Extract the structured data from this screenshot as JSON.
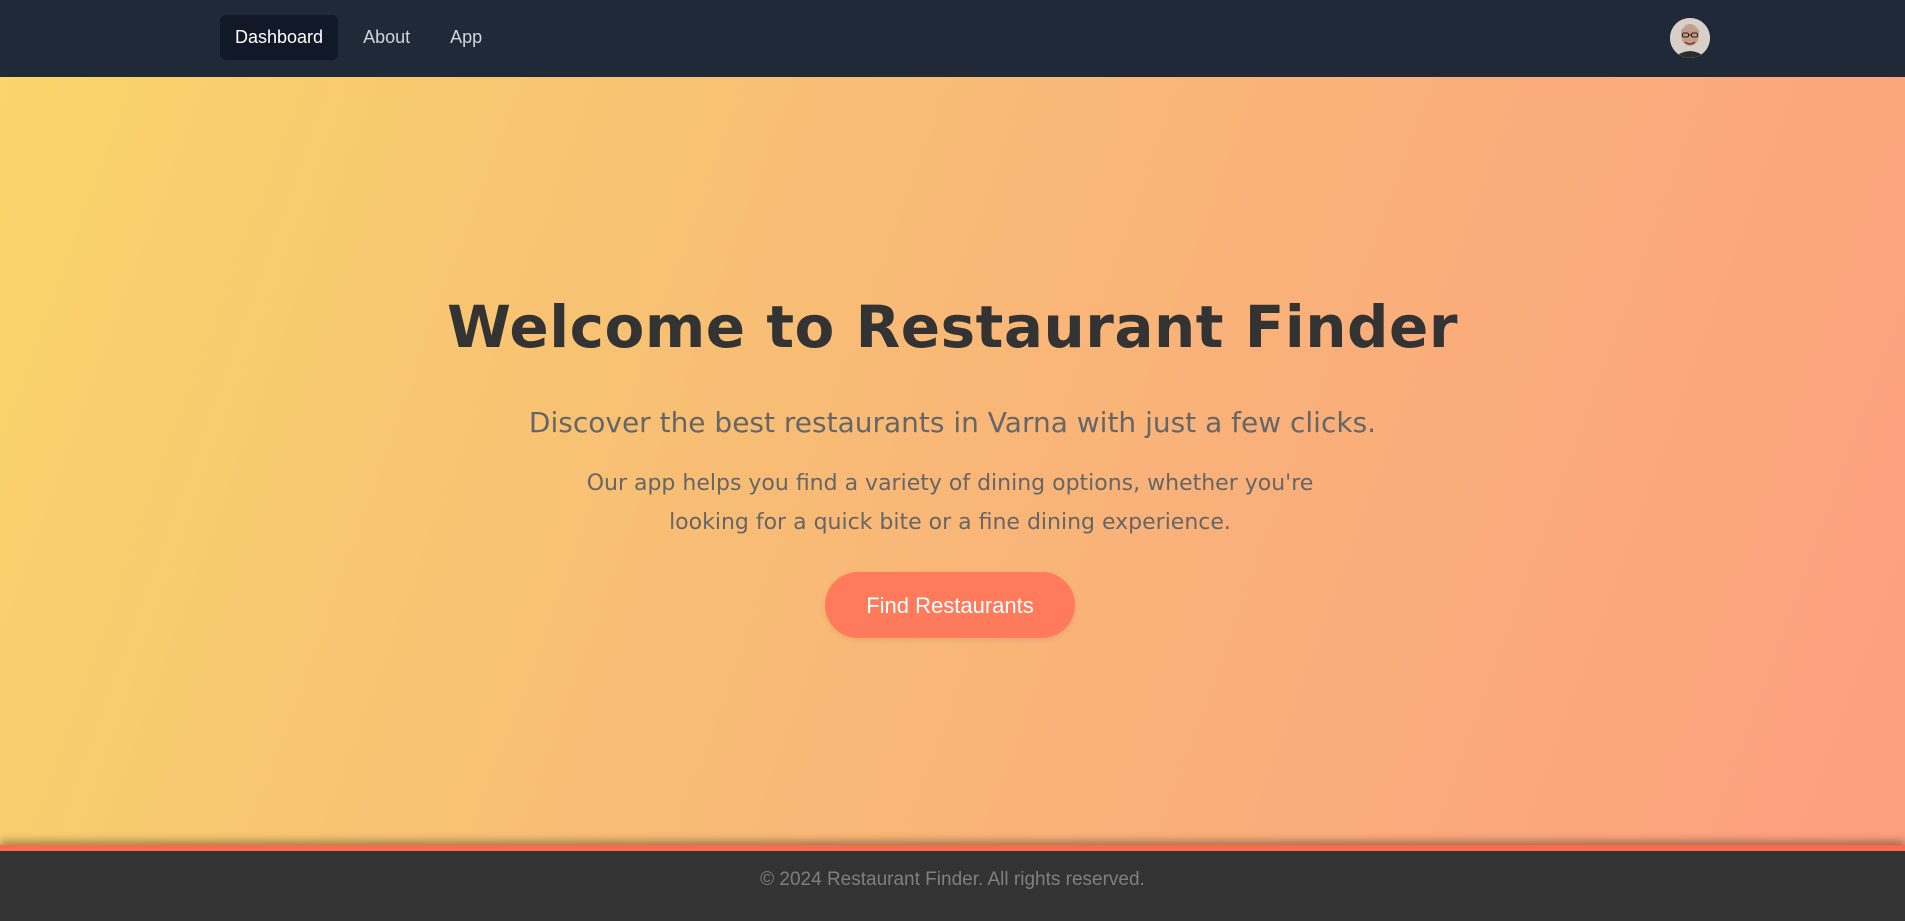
{
  "nav": {
    "links": [
      {
        "label": "Dashboard",
        "active": true
      },
      {
        "label": "About",
        "active": false
      },
      {
        "label": "App",
        "active": false
      }
    ],
    "avatar_icon": "user-avatar-icon"
  },
  "hero": {
    "title": "Welcome to Restaurant Finder",
    "subtitle": "Discover the best restaurants in Varna with just a few clicks.",
    "description": "Our app helps you find a variety of dining options, whether you're looking for a quick bite or a fine dining experience.",
    "cta_label": "Find Restaurants"
  },
  "footer": {
    "text": "© 2024 Restaurant Finder. All rights reserved."
  },
  "colors": {
    "nav_bg": "#1f2937",
    "active_link_bg": "#111827",
    "cta_bg": "#ff7b5c",
    "footer_bg": "#333333",
    "footer_accent": "#fb6a4a",
    "hero_gradient_start": "#f9d56a",
    "hero_gradient_end": "#fc9f7f"
  }
}
